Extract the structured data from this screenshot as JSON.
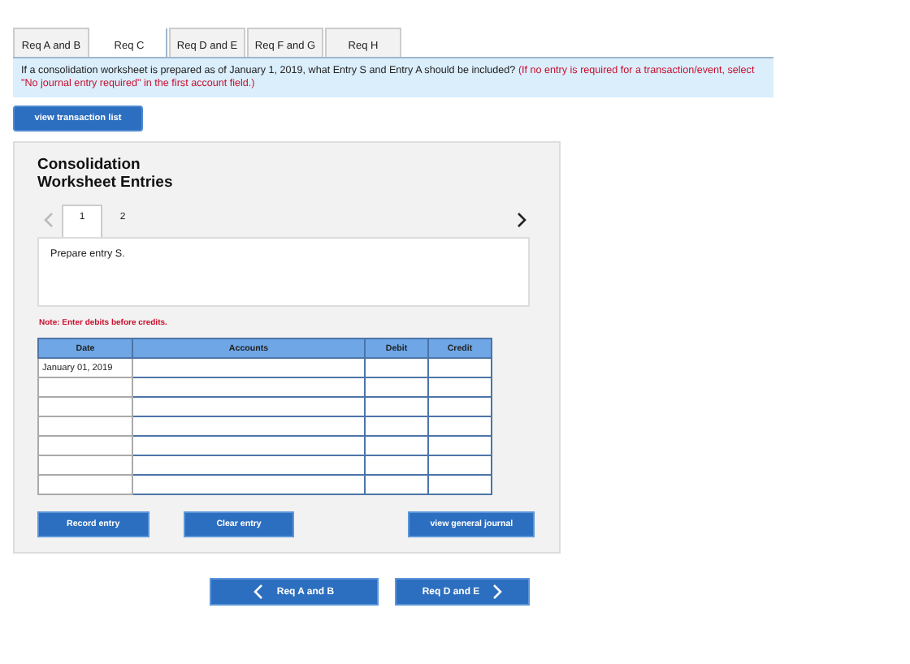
{
  "tabs": [
    {
      "label": "Req A and B",
      "selected": false
    },
    {
      "label": "Req C",
      "selected": true
    },
    {
      "label": "Req D and E",
      "selected": false
    },
    {
      "label": "Req F and G",
      "selected": false
    },
    {
      "label": "Req H",
      "selected": false
    }
  ],
  "question": {
    "text": "If a consolidation worksheet is prepared as of January 1, 2019, what Entry S and Entry A should be included?",
    "instruction": "(If no entry is required for a transaction/event, select \"No journal entry required\" in the first account field.)"
  },
  "transaction_button": "view transaction list",
  "panel": {
    "title": "Consolidation Worksheet Entries",
    "prev_disabled": true,
    "next_disabled": false,
    "entry_tabs": [
      {
        "label": "1",
        "selected": true
      },
      {
        "label": "2",
        "selected": false
      }
    ],
    "prompt": "Prepare entry S.",
    "note": "Note: Enter debits before credits.",
    "table": {
      "columns": [
        "Date",
        "Accounts",
        "Debit",
        "Credit"
      ],
      "rows": [
        {
          "date": "January 01, 2019"
        },
        {
          "date": ""
        },
        {
          "date": ""
        },
        {
          "date": ""
        },
        {
          "date": ""
        },
        {
          "date": ""
        },
        {
          "date": ""
        }
      ]
    },
    "buttons": [
      "Record entry",
      "Clear entry",
      "view general journal"
    ]
  },
  "nav": {
    "previous": "Req A and B",
    "next": "Req D and E"
  }
}
